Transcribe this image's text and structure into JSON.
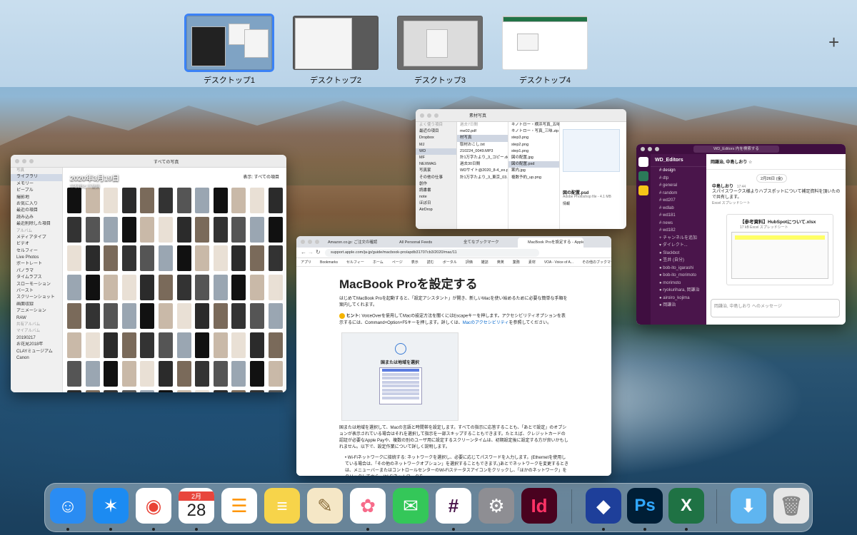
{
  "spaces": [
    {
      "label": "デスクトップ1",
      "active": true
    },
    {
      "label": "デスクトップ2",
      "active": false
    },
    {
      "label": "デスクトップ3",
      "active": false
    },
    {
      "label": "デスクトップ4",
      "active": false
    }
  ],
  "add_space_label": "+",
  "photos": {
    "toolbar_title": "すべての写真",
    "date_heading": "2020年3月19日",
    "location": "早稲田と千葉県",
    "filter_button": "表示: すべての項目",
    "sidebar": [
      "写真",
      "ライブラリ",
      "メモリー",
      "ピープル",
      "撮影地",
      "お気に入り",
      "最近の項目",
      "読み込み",
      "最近削除した項目",
      "アルバム",
      "メディアタイプ",
      "ビデオ",
      "セルフィー",
      "Live Photos",
      "ポートレート",
      "パノラマ",
      "タイムラプス",
      "スローモーション",
      "バースト",
      "スクリーンショット",
      "画面収録",
      "アニメーション",
      "RAW",
      "共有アルバム",
      "マイアルバム",
      "20190217",
      "お花見2018年",
      "CLAYミュージアム",
      "Canon"
    ]
  },
  "finder": {
    "title": "素材写真",
    "sidebar": [
      "よく使う項目",
      "最近の項目",
      "Dropbox",
      "MJ",
      "WD",
      "MF",
      "NEXMAG",
      "写真家",
      "その他の仕事",
      "創作",
      "読書書",
      "note",
      "ほぼ日",
      "AirDrop"
    ],
    "col1_header": "過去7日間",
    "col1": [
      "me02.pdf",
      "材写真",
      "取材おこし.txt",
      "210224_0049.MP3",
      "計1万字たより_3_コピー.docx",
      "過去30日間",
      "WDサイト@2020_8-4_ex.pdf",
      "計1万字たより_3_東京_03.docx"
    ],
    "col2": [
      "キノトロー・横浜写真_五味.",
      "キノトロー・写真_三味.zip",
      "step3.png",
      "step2.png",
      "step1.png",
      "図の配置.jpg",
      "図の配置.psd",
      "案内.jpg",
      "複数予約_up.png"
    ],
    "preview_name": "図の配置.psd",
    "preview_meta": "Adobe Photoshop file - 4.1 MB",
    "preview_info": "情報"
  },
  "slack": {
    "search": "WD_Editors 内を検索する",
    "workspace": "WD_Editors",
    "channels": [
      "design",
      "dtp",
      "general",
      "random",
      "wd207",
      "wdlab",
      "wd181",
      "news",
      "wd182",
      "チャンネルを追加",
      "ダイレクト...",
      "Slackbot",
      "笠井 (自分)",
      "bob-ito_igarashi",
      "bob-ito_morimoto",
      "morimoto",
      "ryokurihara, 岡謙治",
      "airoiro_kojima",
      "岡謙治"
    ],
    "dm_header": "岡謙治, 中島しおり ☆",
    "date_divider": "2月26日 (金)",
    "sender": "中島しおり",
    "time": "17:44",
    "message": "スパイスワークス様よりハブスポットについて補足資料を頂いたので共有します。",
    "attach_note": "Excel スプレッドシート",
    "file_title": "【参考資料】HubSpotについて.xlsx",
    "file_sub": "17 kB Excel スプレッドシート",
    "input_placeholder": "岡謙治, 中島しおり へのメッセージ"
  },
  "chrome": {
    "tabs": [
      "Amazon.co.jp: ご注文の確認",
      "All Personal Feeds",
      "全てなブックマーク",
      "MacBook Proを設定する - Apple"
    ],
    "url": "support.apple.com/ja-jp/guide/macbook-pro/apdb31707cb3/2020/mac/11",
    "bookmarks": [
      "アプリ",
      "Bookmarks",
      "セルフィー",
      "ホーム",
      "ページ",
      "表示",
      "読む",
      "ボータル",
      "評価",
      "雑誌",
      "英英",
      "業務",
      "素材",
      "VOA - Voice of A...",
      "その他のブックマーク"
    ],
    "heading": "MacBook Proを設定する",
    "intro": "はじめてMacBook Proを起動すると、「設定アシスタント」が開き、新しいMacを使い始めるために必要な簡単な手順を案内してくれます。",
    "hint_label": "ヒント:",
    "hint": "VoiceOverを使用してMacの設定方法を聞くにはEscapeキーを押します。アクセシビリティオプションを表示するには、Command+Option+F5キーを押します。詳しくは、",
    "hint_link": "Macのアクセシビリティ",
    "hint_tail": "を参照してください。",
    "screenshot_caption": "国または地域を選択",
    "body": "国または地域を選択して、Macの言語と時間帯を設定します。すべての指示に応答することも、「あとで設定」のオプションが表示されている場合はそれを選択して指示を一部スキップすることもできます。たとえば、クレジットカードの認証が必要なApple Payや、複数の別のユーザ用に設定するスクリーンタイムは、初期設定後に設定する方が良いかもしれません。以下で、設定作業について詳しく説明します。",
    "bullet": "Wi-Fiネットワークに接続する: ネットワークを選択し、必要に応じてパスワードを入力します。(Ethernetを使用している場合は、「その他のネットワークオプション」を選択することもできます。)あとでネットワークを変更するときは、メニューバーまたはコントロールセンターのWi-Fiステータスアイコンをクリックし、「ほかのネットワーク」をクリックしてから、Wi-Fiネットワークを"
  },
  "dock": {
    "apps": [
      {
        "name": "finder-app",
        "icon": "finder-icon",
        "color": "#2a8cf3",
        "running": true
      },
      {
        "name": "safari-app",
        "icon": "safari-icon",
        "color": "#1c8bf2",
        "running": true
      },
      {
        "name": "chrome-app",
        "icon": "chrome-icon",
        "color": "#ffffff",
        "running": true
      },
      {
        "name": "calendar-app",
        "icon": "calendar-icon",
        "color": "#ffffff",
        "running": true
      },
      {
        "name": "reminders-app",
        "icon": "reminders-icon",
        "color": "#ffffff",
        "running": false
      },
      {
        "name": "notes-app",
        "icon": "notes-icon",
        "color": "#f7d44a",
        "running": false
      },
      {
        "name": "textedit-app",
        "icon": "textedit-icon",
        "color": "#f5e7c6",
        "running": false
      },
      {
        "name": "photos-app",
        "icon": "photos-icon",
        "color": "#ffffff",
        "running": true
      },
      {
        "name": "messages-app",
        "icon": "messages-icon",
        "color": "#34c759",
        "running": false
      },
      {
        "name": "slack-app",
        "icon": "slack-icon",
        "color": "#ffffff",
        "running": true
      },
      {
        "name": "system-preferences-app",
        "icon": "gear-icon",
        "color": "#8e8e93",
        "running": false
      },
      {
        "name": "indesign-app",
        "icon": "indesign-icon",
        "color": "#49021f",
        "running": false
      },
      {
        "name": "dropbox-app",
        "icon": "dropbox-icon",
        "color": "#1e3f9a",
        "running": true
      },
      {
        "name": "photoshop-app",
        "icon": "photoshop-icon",
        "color": "#001e36",
        "running": true
      },
      {
        "name": "excel-app",
        "icon": "excel-icon",
        "color": "#1f7244",
        "running": true
      },
      {
        "name": "downloads-folder",
        "icon": "downloads-folder-icon",
        "color": "#5fb5f0",
        "running": false
      },
      {
        "name": "trash",
        "icon": "trash-icon",
        "color": "#e6e6e6",
        "running": false
      }
    ],
    "calendar_month": "2月",
    "calendar_day": "28",
    "indesign_label": "Id",
    "photoshop_label": "Ps",
    "excel_label": "X"
  }
}
